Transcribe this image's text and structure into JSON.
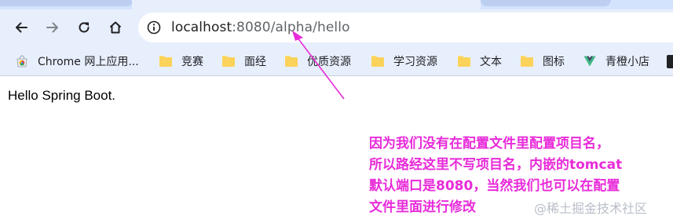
{
  "browser": {
    "url_host": "localhost",
    "url_rest": ":8080/alpha/hello"
  },
  "bookmarks": [
    {
      "label": "Chrome 网上应用...",
      "icon": "chrome-store-icon"
    },
    {
      "label": "竞赛",
      "icon": "folder-icon"
    },
    {
      "label": "面经",
      "icon": "folder-icon"
    },
    {
      "label": "优质资源",
      "icon": "folder-icon"
    },
    {
      "label": "学习资源",
      "icon": "folder-icon"
    },
    {
      "label": "文本",
      "icon": "folder-icon"
    },
    {
      "label": "图标",
      "icon": "folder-icon"
    },
    {
      "label": "青橙小店",
      "icon": "vue-icon"
    }
  ],
  "page": {
    "body_text": "Hello Spring Boot."
  },
  "annotation": {
    "lines": [
      "因为我们没有在配置文件里配置项目名，",
      "所以路经这里不写项目名，内嵌的tomcat",
      "默认端口是8080，当然我们也可以在配置",
      "文件里面进行修改"
    ],
    "color": "#e82bd9"
  },
  "watermark": "@稀土掘金技术社区"
}
